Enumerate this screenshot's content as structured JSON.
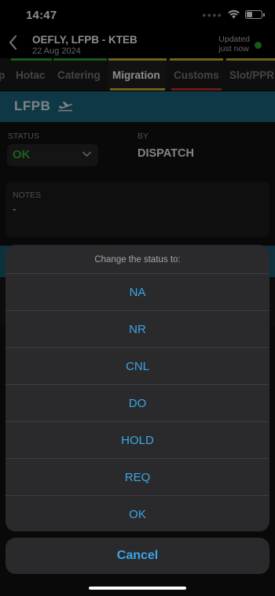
{
  "status_bar": {
    "time": "14:47",
    "signal_icon": "dots-icon",
    "wifi_icon": "wifi-icon",
    "battery_icon": "battery-icon"
  },
  "header": {
    "back_icon": "chevron-left-icon",
    "title": "OEFLY, LFPB - KTEB",
    "date": "22 Aug 2024",
    "updated_line1": "Updated",
    "updated_line2": "just now",
    "status_dot_color": "#2ca52c"
  },
  "tabs": [
    {
      "label": "p",
      "bar_color": ""
    },
    {
      "label": "Hotac",
      "bar_color": "#2ca52c"
    },
    {
      "label": "Catering",
      "bar_color": "#2ca52c"
    },
    {
      "label": "Migration",
      "bar_color": "#c9b02d",
      "active": true
    },
    {
      "label": "Customs",
      "bar_color": "#c9b02d",
      "bottom_color": "#c0302a"
    },
    {
      "label": "Slot/PPR",
      "bar_color": "#c9b02d"
    }
  ],
  "airport": {
    "code": "LFPB",
    "icon": "departure-plane-icon"
  },
  "status_section": {
    "status_label": "STATUS",
    "status_value": "OK",
    "status_color": "#32b02f",
    "by_label": "BY",
    "by_value": "DISPATCH",
    "notes_label": "NOTES",
    "notes_value": "-"
  },
  "action_sheet": {
    "title": "Change the status to:",
    "options": [
      "NA",
      "NR",
      "CNL",
      "DO",
      "HOLD",
      "REQ",
      "OK"
    ],
    "cancel_label": "Cancel",
    "accent_color": "#3aa6e8"
  }
}
